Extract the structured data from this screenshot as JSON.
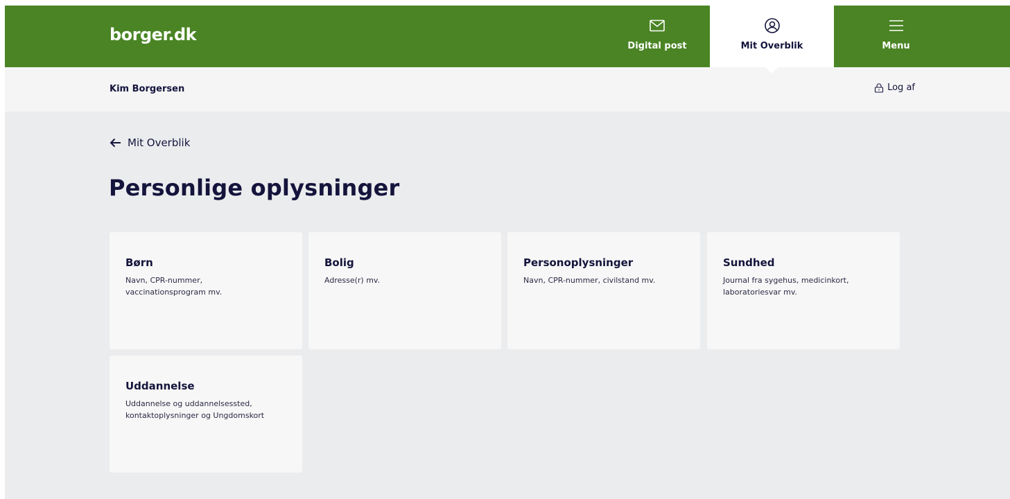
{
  "header": {
    "logo": "borger.dk",
    "nav": {
      "digital_post": "Digital post",
      "mit_overblik": "Mit Overblik",
      "menu": "Menu"
    }
  },
  "subbar": {
    "user_name": "Kim Borgersen",
    "logout_label": "Log af"
  },
  "main": {
    "back_label": "Mit Overblik",
    "title": "Personlige oplysninger",
    "cards": [
      {
        "title": "Børn",
        "desc": "Navn, CPR-nummer, vaccinationsprogram mv."
      },
      {
        "title": "Bolig",
        "desc": "Adresse(r) mv."
      },
      {
        "title": "Personoplysninger",
        "desc": "Navn, CPR-nummer, civilstand mv."
      },
      {
        "title": "Sundhed",
        "desc": "Journal fra sygehus, medicinkort, laboratoriesvar mv."
      },
      {
        "title": "Uddannelse",
        "desc": "Uddannelse og uddannelsessted, kontaktoplysninger og Ungdomskort"
      }
    ]
  },
  "colors": {
    "brand_green": "#4a8424",
    "text_navy": "#14143c",
    "page_bg": "#ebecee",
    "card_bg": "#f7f7f7"
  },
  "icons": {
    "digital_post": "envelope-icon",
    "mit_overblik": "user-circle-icon",
    "menu": "hamburger-icon",
    "logout": "lock-icon",
    "back": "arrow-left-icon"
  }
}
